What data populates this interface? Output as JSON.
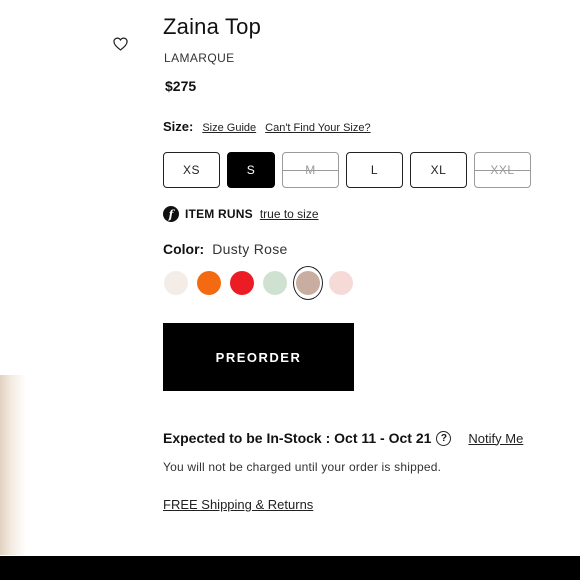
{
  "product": {
    "title": "Zaina Top",
    "brand": "LAMARQUE",
    "price": "$275"
  },
  "size": {
    "label": "Size:",
    "guide_link": "Size Guide",
    "cant_find_link": "Can't Find Your Size?",
    "options": [
      {
        "label": "XS",
        "state": "available"
      },
      {
        "label": "S",
        "state": "selected"
      },
      {
        "label": "M",
        "state": "unavailable"
      },
      {
        "label": "L",
        "state": "available"
      },
      {
        "label": "XL",
        "state": "available"
      },
      {
        "label": "XXL",
        "state": "unavailable"
      }
    ]
  },
  "fit": {
    "badge": "f",
    "label": "ITEM RUNS",
    "value": "true to size"
  },
  "color": {
    "label": "Color:",
    "selected": "Dusty Rose",
    "swatches": [
      {
        "name": "cream",
        "hex": "#f4ece6"
      },
      {
        "name": "orange",
        "hex": "#f46a12"
      },
      {
        "name": "red",
        "hex": "#ec1c24"
      },
      {
        "name": "sage",
        "hex": "#cfe2d2"
      },
      {
        "name": "dusty-rose",
        "hex": "#c9ada0",
        "selected": true
      },
      {
        "name": "blush",
        "hex": "#f6dad7"
      }
    ]
  },
  "cta": {
    "preorder_label": "PREORDER"
  },
  "stock": {
    "text": "Expected to be In-Stock : Oct 11 - Oct 21",
    "help_icon": "?",
    "notify_link": "Notify Me",
    "charge_note": "You will not be charged until your order is shipped."
  },
  "shipping": {
    "link": "FREE Shipping & Returns"
  },
  "colors": {
    "primary": "#000000",
    "text": "#111111",
    "muted": "#9a9a9a"
  },
  "icons": {
    "wishlist": "heart-icon",
    "fit": "fit-info-icon",
    "help": "question-circle-icon"
  }
}
